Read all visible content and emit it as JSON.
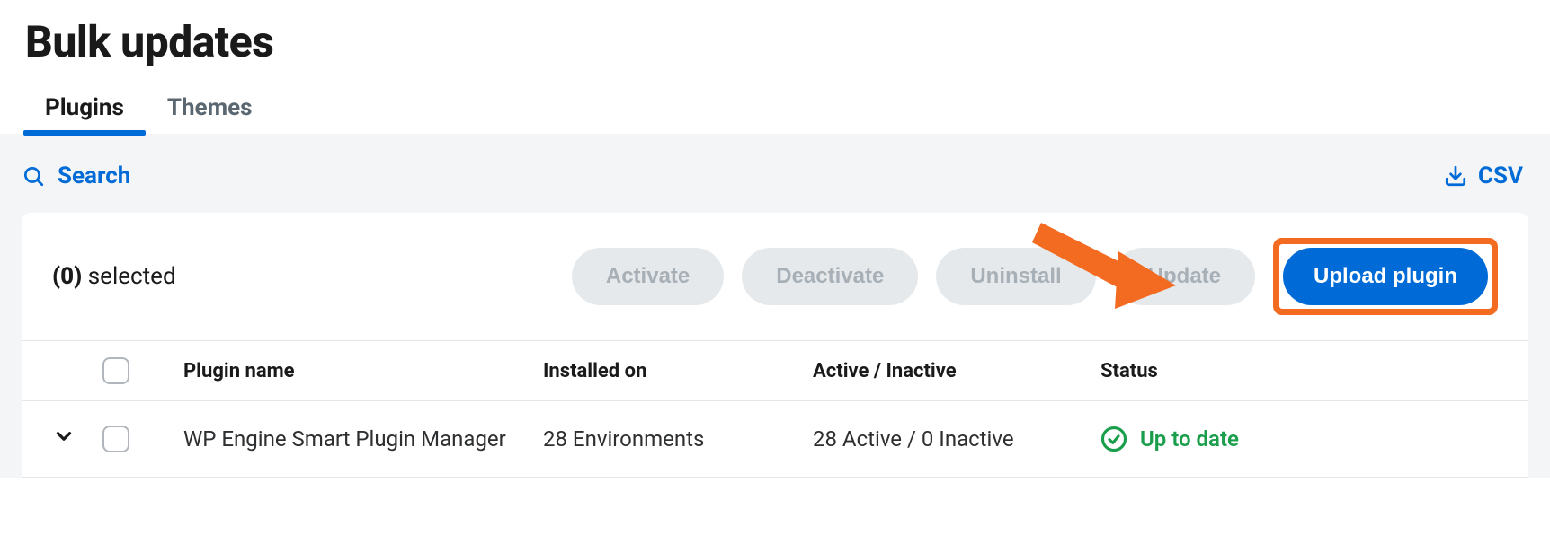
{
  "page": {
    "title": "Bulk updates"
  },
  "tabs": {
    "plugins": "Plugins",
    "themes": "Themes"
  },
  "toolbar": {
    "search_label": "Search",
    "csv_label": "CSV"
  },
  "actions": {
    "selected_count": "(0)",
    "selected_label": "selected",
    "activate": "Activate",
    "deactivate": "Deactivate",
    "uninstall": "Uninstall",
    "update": "Update",
    "upload": "Upload plugin"
  },
  "table": {
    "headers": {
      "name": "Plugin name",
      "installed": "Installed on",
      "active": "Active / Inactive",
      "status": "Status"
    },
    "rows": [
      {
        "name": "WP Engine Smart Plugin Manager",
        "installed": "28 Environments",
        "active": "28 Active / 0 Inactive",
        "status": "Up to date"
      }
    ]
  }
}
